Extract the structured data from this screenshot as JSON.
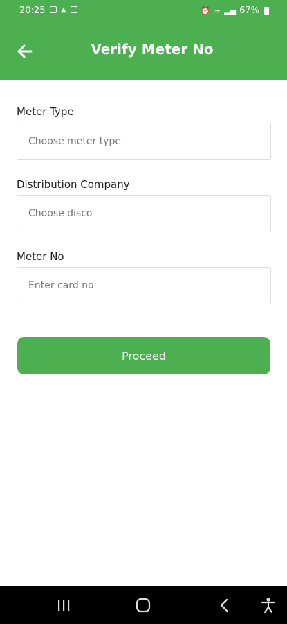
{
  "status_bar": {
    "time": "20:25",
    "battery": "67%",
    "icons": [
      "gallery-icon",
      "notification-icon",
      "message-icon",
      "alarm-icon",
      "wifi-icon",
      "signal-icon",
      "battery-icon"
    ]
  },
  "app_bar": {
    "title": "Verify Meter No",
    "back_icon": "arrow-left-icon",
    "background": "#4CAF50"
  },
  "form": {
    "meter_type": {
      "label": "Meter Type",
      "placeholder": "Choose meter type"
    },
    "distribution_company": {
      "label": "Distribution Company",
      "placeholder": "Choose disco"
    },
    "meter_no": {
      "label": "Meter No",
      "placeholder": "Enter card no"
    },
    "submit_label": "Proceed"
  },
  "nav_bar": {
    "buttons": [
      "recents-icon",
      "home-icon",
      "back-icon",
      "accessibility-icon"
    ]
  }
}
